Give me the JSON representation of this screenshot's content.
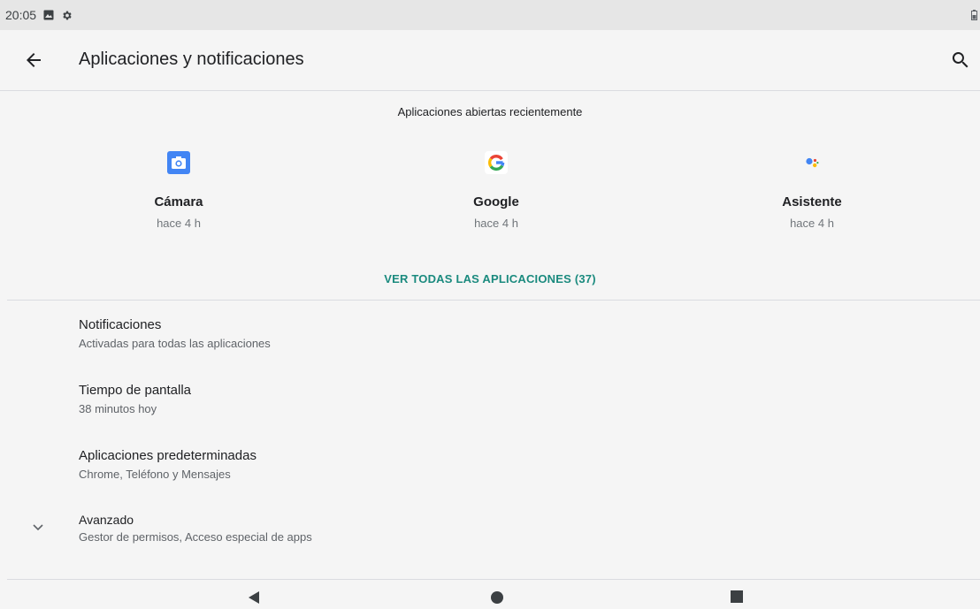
{
  "status_bar": {
    "time": "20:05"
  },
  "app_bar": {
    "title": "Aplicaciones y notificaciones"
  },
  "recent": {
    "header": "Aplicaciones abiertas recientemente",
    "apps": [
      {
        "name": "Cámara",
        "time": "hace 4 h",
        "icon": "camera-icon"
      },
      {
        "name": "Google",
        "time": "hace 4 h",
        "icon": "google-icon"
      },
      {
        "name": "Asistente",
        "time": "hace 4 h",
        "icon": "assistant-icon"
      }
    ],
    "see_all": "VER TODAS LAS APLICACIONES (37)"
  },
  "settings": [
    {
      "title": "Notificaciones",
      "subtitle": "Activadas para todas las aplicaciones"
    },
    {
      "title": "Tiempo de pantalla",
      "subtitle": "38 minutos hoy"
    },
    {
      "title": "Aplicaciones predeterminadas",
      "subtitle": "Chrome, Teléfono y Mensajes"
    },
    {
      "title": "Avanzado",
      "subtitle": "Gestor de permisos, Acceso especial de apps"
    }
  ],
  "colors": {
    "accent": "#1a8a7e",
    "camera": "#4285f4"
  }
}
